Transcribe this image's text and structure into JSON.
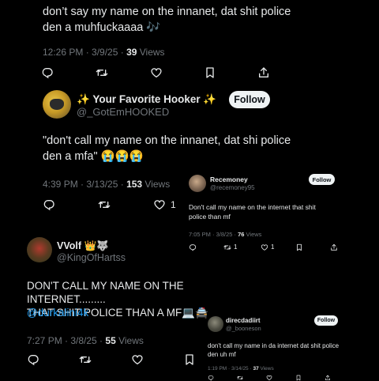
{
  "tweet1": {
    "text": "don’t say my name on the innanet, dat shit police\nden a muhfuckaaaa 🎶",
    "time": "12:26 PM · 3/9/25 · ",
    "views_count": "39",
    "views_label": " Views"
  },
  "tweet2": {
    "display_name": "✨ Your Favorite Hooker ✨",
    "handle": "@_GotEmHOOKED",
    "follow_label": "Follow",
    "text": "\"don't call my name on the innanet, dat shi police\nden a mfa\" 😭😭😭",
    "time": "4:39 PM · 3/13/25 · ",
    "views_count": "153",
    "views_label": " Views",
    "like_count": "1"
  },
  "tweet3": {
    "display_name": "Recemoney",
    "handle": "@recemoney95",
    "follow_label": "Follow",
    "text": "Don't call my name on the internet that shit\npolice than mf",
    "time": "7:05 PM · 3/8/25 · ",
    "views_count": "76",
    "views_label": " Views",
    "retweet_count": "1",
    "like_count": "1"
  },
  "tweet4": {
    "display_name": "VVolf 👑🐺",
    "handle": "@KingOfHartss",
    "text": "DON'T CALL MY NAME ON THE INTERNET.........\nTHAT SHIT POLICE THAN A MF💻🚔",
    "mention": "@durkalini4k",
    "time": "7:27 PM · 3/8/25 · ",
    "views_count": "55",
    "views_label": " Views"
  },
  "tweet5": {
    "display_name": "direcdadiirt",
    "handle": "@_booneson",
    "follow_label": "Follow",
    "text": "don't call my name in da internet dat shit police\nden uh mf",
    "time": "1:19 PM · 3/14/25 · ",
    "views_count": "37",
    "views_label": " Views"
  },
  "icons": {
    "colors": {
      "text": "#e7e9ea",
      "muted": "#71767b",
      "link": "#1d9bf0",
      "follow_bg": "#eff3f4"
    }
  }
}
